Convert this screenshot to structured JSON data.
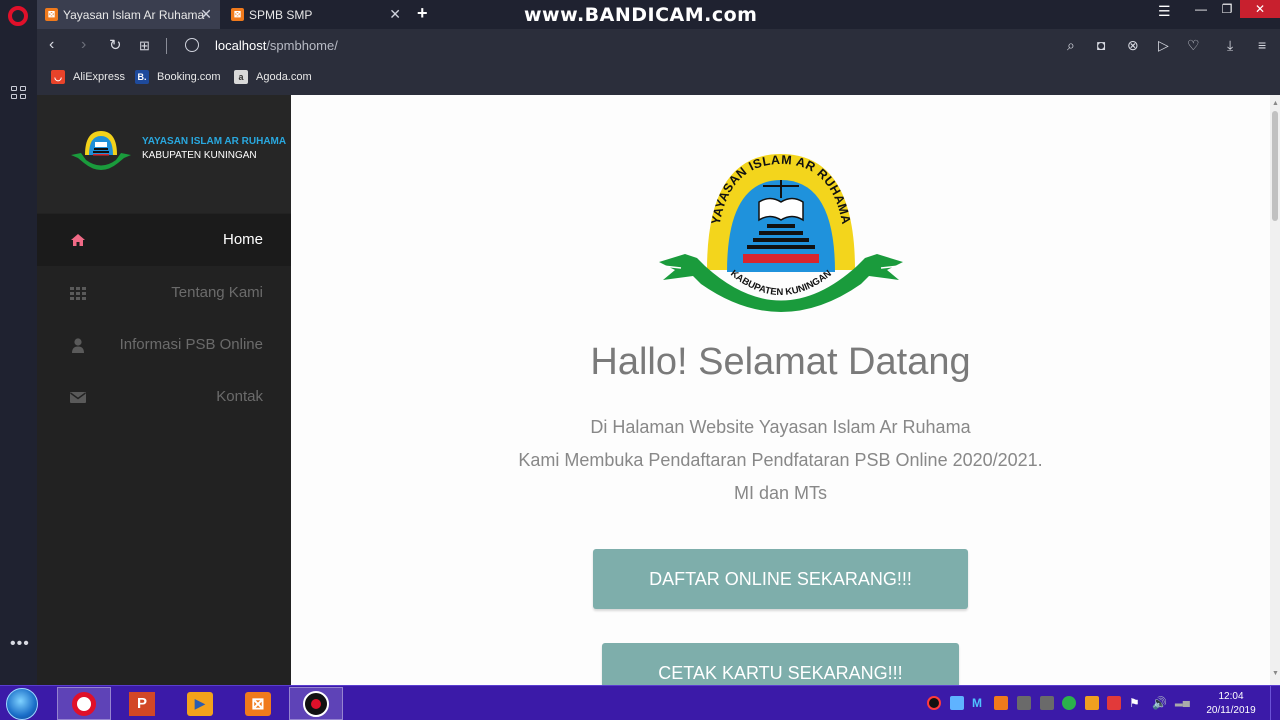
{
  "browser": {
    "tabs": [
      {
        "label": "Yayasan Islam Ar Ruhama",
        "active": true
      },
      {
        "label": "SPMB SMP",
        "active": false
      }
    ],
    "watermark": "www.BANDICAM.com",
    "url_host": "localhost",
    "url_path": "/spmbhome/",
    "bookmarks": [
      {
        "label": "AliExpress",
        "color": "#e8432a"
      },
      {
        "label": "Booking.com",
        "color": "#1e4a9c"
      },
      {
        "label": "Agoda.com",
        "color": "#d9d9d9"
      }
    ]
  },
  "site": {
    "brand_name": "YAYASAN ISLAM AR RUHAMA",
    "brand_sub": "KABUPATEN KUNINGAN",
    "logo_ring_text": "YAYASAN ISLAM AR RUHAMA",
    "logo_ribbon_text": "KABUPATEN KUNINGAN",
    "nav": [
      {
        "label": "Home",
        "icon": "home-icon",
        "active": true
      },
      {
        "label": "Tentang Kami",
        "icon": "grid-icon",
        "active": false
      },
      {
        "label": "Informasi PSB Online",
        "icon": "user-icon",
        "active": false
      },
      {
        "label": "Kontak",
        "icon": "envelope-icon",
        "active": false
      }
    ],
    "greeting": "Hallo! Selamat Datang",
    "intro_lines": [
      "Di Halaman Website Yayasan Islam Ar Ruhama",
      "Kami Membuka Pendaftaran Pendfataran PSB Online 2020/2021.",
      "MI dan MTs"
    ],
    "cta_register": "DAFTAR ONLINE SEKARANG!!!",
    "cta_print": "CETAK KARTU SEKARANG!!!",
    "accent_color": "#7eaeab"
  },
  "taskbar": {
    "time": "12:04",
    "date": "20/11/2019"
  }
}
